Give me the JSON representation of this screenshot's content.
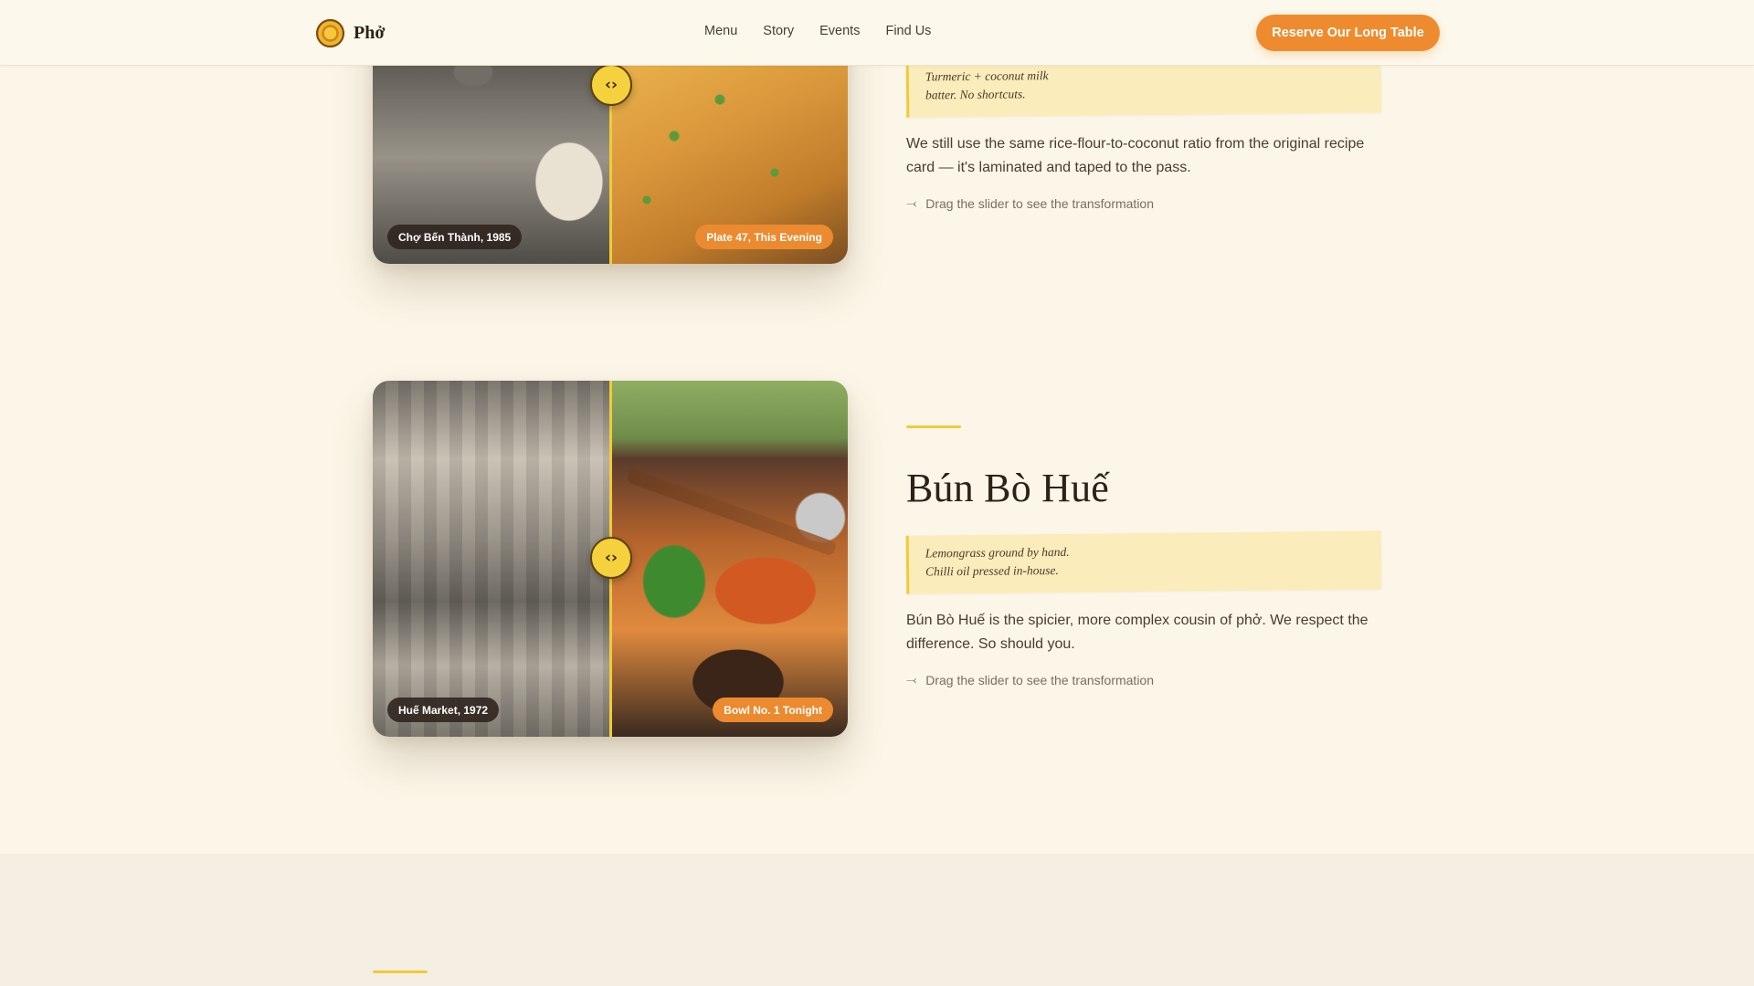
{
  "nav": {
    "brand": "Phở",
    "links": [
      "Menu",
      "Story",
      "Events",
      "Find Us"
    ],
    "cta": "Reserve Our Long Table"
  },
  "sections": [
    {
      "note_lines": [
        "Turmeric + coconut milk",
        "batter. No shortcuts."
      ],
      "description": "We still use the same rice-flour-to-coconut ratio from the original recipe card — it's laminated and taped to the pass.",
      "hint": "Drag the slider to see the transformation",
      "before_label": "Chợ Bến Thành, 1985",
      "after_label": "Plate 47, This Evening",
      "handle_glyph": "‹›"
    },
    {
      "title": "Bún Bò Huế",
      "note_lines": [
        "Lemongrass ground by hand.",
        "Chilli oil pressed in-house."
      ],
      "description": "Bún Bò Huế is the spicier, more complex cousin of phở. We respect the difference. So should you.",
      "hint": "Drag the slider to see the transformation",
      "before_label": "Huế Market, 1972",
      "after_label": "Bowl No. 1 Tonight",
      "handle_glyph": "‹›"
    }
  ],
  "colors": {
    "accent_orange": "#ee8b2e",
    "accent_yellow": "#f0cb3a",
    "background": "#fcf6e8"
  },
  "icons": {
    "hint": "drag-arrows-icon",
    "logo": "logo-icon"
  }
}
